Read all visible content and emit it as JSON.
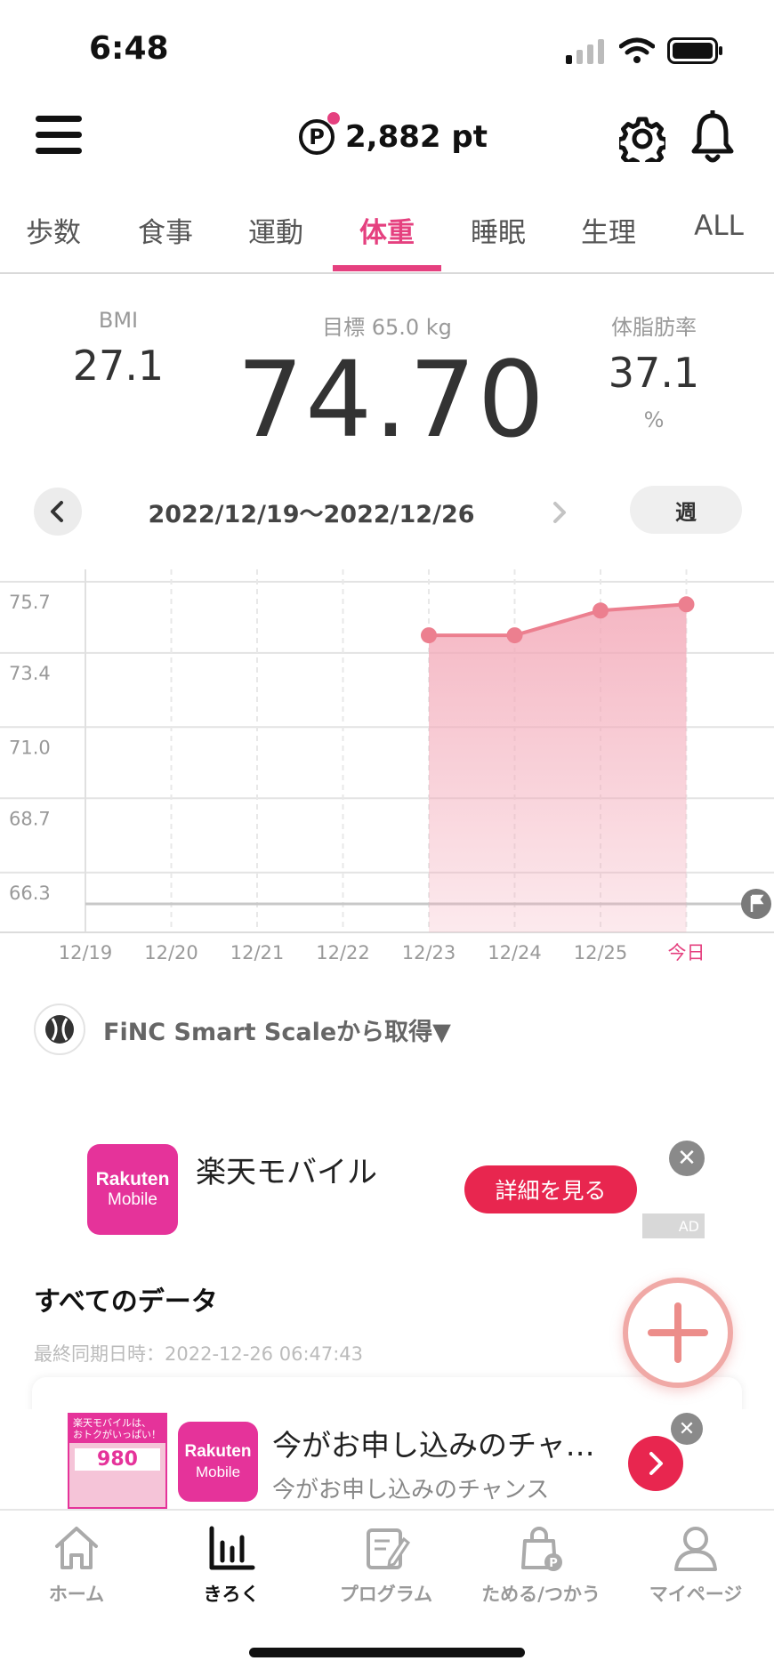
{
  "status_bar": {
    "time": "6:48"
  },
  "header": {
    "points": "2,882 pt",
    "points_icon": "P"
  },
  "tabs": [
    {
      "label": "歩数",
      "active": false
    },
    {
      "label": "食事",
      "active": false
    },
    {
      "label": "運動",
      "active": false
    },
    {
      "label": "体重",
      "active": true
    },
    {
      "label": "睡眠",
      "active": false
    },
    {
      "label": "生理",
      "active": false
    },
    {
      "label": "ALL",
      "active": false
    }
  ],
  "stats": {
    "bmi_label": "BMI",
    "bmi_value": "27.1",
    "goal_label": "目標 65.0 kg",
    "weight": "74.70",
    "fat_label": "体脂肪率",
    "fat_value": "37.1",
    "fat_unit": "%"
  },
  "date_nav": {
    "range": "2022/12/19〜2022/12/26",
    "period": "週"
  },
  "chart_data": {
    "type": "area",
    "y_tick_labels": [
      "75.7",
      "73.4",
      "71.0",
      "68.7",
      "66.3"
    ],
    "ylim": [
      65.0,
      76.5
    ],
    "categories": [
      "12/19",
      "12/20",
      "12/21",
      "12/22",
      "12/23",
      "12/24",
      "12/25",
      "今日"
    ],
    "values": [
      null,
      null,
      null,
      null,
      74.6,
      74.6,
      75.4,
      75.6
    ],
    "goal_line": 65.0,
    "series_color": "#ec7f8f",
    "today_color": "#e5407f",
    "grid": true
  },
  "source": {
    "label": "FiNC Smart Scaleから取得▼"
  },
  "ad_top": {
    "logo_line1": "Rakuten",
    "logo_line2": "Mobile",
    "title": "楽天モバイル",
    "cta": "詳細を見る",
    "close": "✕",
    "badge": "AD"
  },
  "all_data": {
    "title": "すべてのデータ",
    "last_sync": "最終同期日時：2022-12-26 06:47:43"
  },
  "ad_bottom": {
    "thumb_line1": "楽天モバイルは、",
    "thumb_line2": "おトクがいっぱい！",
    "thumb_price": "980",
    "logo_line1": "Rakuten",
    "logo_line2": "Mobile",
    "title": "今がお申し込みのチャ…",
    "subtitle": "今がお申し込みのチャンス",
    "close": "✕"
  },
  "bottom_nav": [
    {
      "label": "ホーム",
      "icon": "home-icon",
      "active": false
    },
    {
      "label": "きろく",
      "icon": "bar-chart-icon",
      "active": true
    },
    {
      "label": "プログラム",
      "icon": "program-icon",
      "active": false
    },
    {
      "label": "ためる/つかう",
      "icon": "shopping-bag-icon",
      "active": false
    },
    {
      "label": "マイページ",
      "icon": "person-icon",
      "active": false
    }
  ],
  "colors": {
    "accent": "#e5407f",
    "ad_red": "#e8264f",
    "rakuten": "#e5339a"
  }
}
